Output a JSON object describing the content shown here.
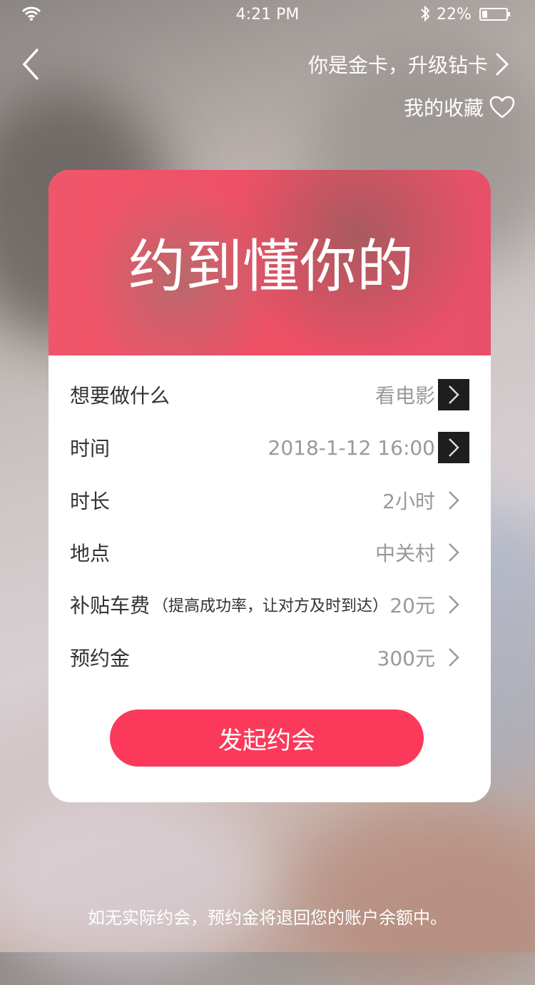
{
  "status_bar": {
    "time": "4:21 PM",
    "battery": "22%",
    "battery_level": 0.22
  },
  "header": {
    "upgrade_link": "你是金卡，升级钻卡",
    "favorites": "我的收藏"
  },
  "card": {
    "title": "约到懂你的",
    "rows": [
      {
        "label": "想要做什么",
        "value": "看电影",
        "note": ""
      },
      {
        "label": "时间",
        "value": "2018-1-12  16:00",
        "note": ""
      },
      {
        "label": "时长",
        "value": "2小时",
        "note": ""
      },
      {
        "label": "地点",
        "value": "中关村",
        "note": ""
      },
      {
        "label": "补贴车费",
        "value": "20元",
        "note": "（提高成功率，让对方及时到达）"
      },
      {
        "label": "预约金",
        "value": "300元",
        "note": ""
      }
    ],
    "submit_label": "发起约会"
  },
  "footer": {
    "notice": "如无实际约会，预约金将退回您的账户余额中。"
  },
  "colors": {
    "accent": "#FB3A5B",
    "hero": "#EE5066",
    "label": "#333333",
    "value": "#999999",
    "white": "#FFFFFF"
  },
  "icons": [
    "wifi-icon",
    "bluetooth-icon",
    "battery-icon",
    "back-chevron-icon",
    "chevron-right-icon",
    "heart-icon"
  ]
}
